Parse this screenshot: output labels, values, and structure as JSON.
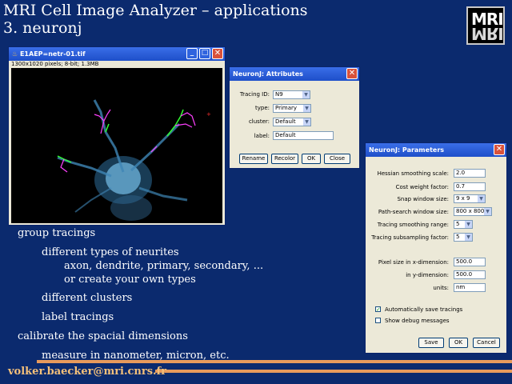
{
  "slide": {
    "title_line1": "MRI Cell Image Analyzer – applications",
    "title_line2": "3. neuronj",
    "logo_text": "MRI",
    "email": "volker.baecker@mri.cnrs.fr"
  },
  "bullets": [
    "group tracings",
    "different types of neurites",
    "axon, dendrite, primary, secondary, ...",
    "or create your own types",
    "different clusters",
    "label tracings",
    "calibrate the spacial dimensions",
    "measure in nanometer, micron, etc."
  ],
  "image_window": {
    "title": "E1AEP=netr-01.tif",
    "info": "1300x1020 pixels; 8-bit; 1.3MB",
    "min_label": "_",
    "max_label": "□",
    "close_label": "✕"
  },
  "attributes_dialog": {
    "title": "NeuronJ: Attributes",
    "close_label": "✕",
    "tracing_id_label": "Tracing ID:",
    "tracing_id_value": "N9",
    "type_label": "type:",
    "type_value": "Primary",
    "cluster_label": "cluster:",
    "cluster_value": "Default",
    "label_label": "label:",
    "label_value": "Default",
    "buttons": [
      "Rename",
      "Recolor",
      "OK",
      "Close"
    ]
  },
  "parameters_dialog": {
    "title": "NeuronJ: Parameters",
    "close_label": "✕",
    "hessian_label": "Hessian smoothing scale:",
    "hessian_value": "2.0",
    "cost_label": "Cost weight factor:",
    "cost_value": "0.7",
    "snap_label": "Snap window size:",
    "snap_value": "9 x 9",
    "path_label": "Path-search window size:",
    "path_value": "800 x 800",
    "tracing_smooth_label": "Tracing smoothing range:",
    "tracing_smooth_value": "5",
    "subsampling_label": "Tracing subsampling factor:",
    "subsampling_value": "5",
    "pixel_x_label": "Pixel size in x-dimension:",
    "pixel_x_value": "500.0",
    "pixel_y_label": "in y-dimension:",
    "pixel_y_value": "500.0",
    "units_label": "units:",
    "units_value": "nm",
    "auto_save_label": "Automatically save tracings",
    "auto_save_checked": "✓",
    "debug_label": "Show debug messages",
    "buttons": [
      "Save",
      "OK",
      "Cancel"
    ]
  },
  "colors": {
    "background": "#0b2a6e",
    "footer_line": "#e79a5c",
    "email": "#f4c07a"
  }
}
